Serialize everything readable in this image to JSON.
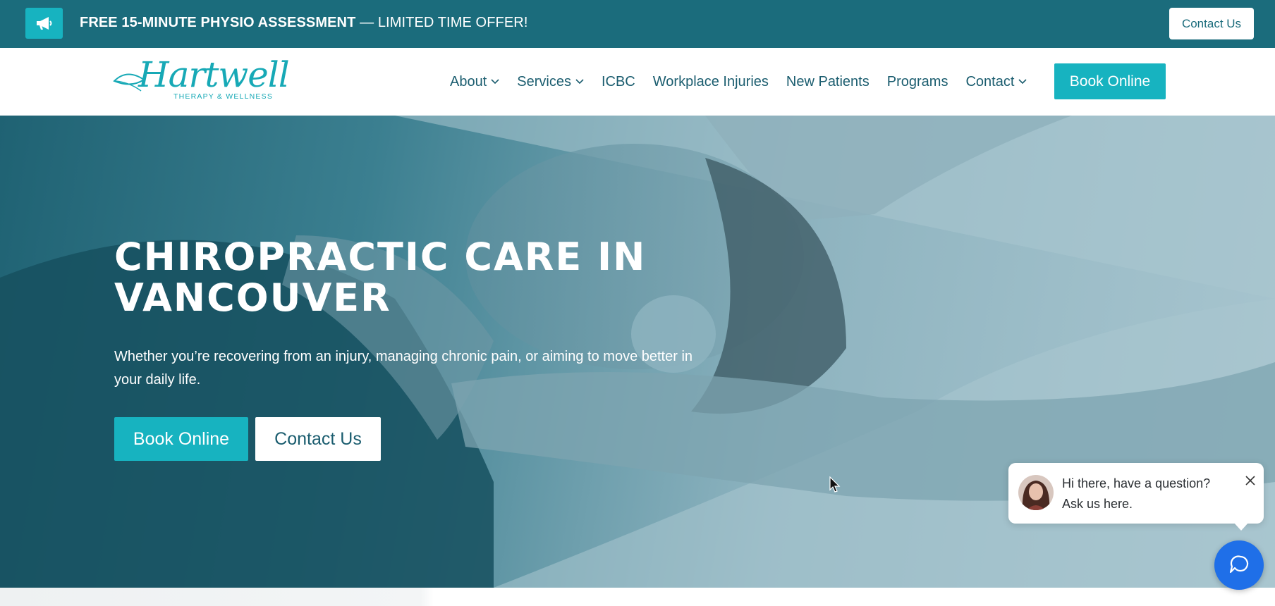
{
  "announcement": {
    "icon": "megaphone-icon",
    "headline": "FREE 15-MINUTE PHYSIO ASSESSMENT",
    "tagline": " — LIMITED TIME OFFER!",
    "contact_label": "Contact Us"
  },
  "header": {
    "logo_name": "Hartwell",
    "logo_tagline": "THERAPY & WELLNESS",
    "nav": [
      {
        "label": "About",
        "dropdown": true
      },
      {
        "label": "Services",
        "dropdown": true
      },
      {
        "label": "ICBC",
        "dropdown": false
      },
      {
        "label": "Workplace Injuries",
        "dropdown": false
      },
      {
        "label": "New Patients",
        "dropdown": false
      },
      {
        "label": "Programs",
        "dropdown": false
      },
      {
        "label": "Contact",
        "dropdown": true
      }
    ],
    "book_label": "Book Online"
  },
  "hero": {
    "title": "CHIROPRACTIC CARE IN VANCOUVER",
    "subtitle": "Whether you’re recovering from an injury, managing chronic pain, or aiming to move better in your daily life.",
    "book_label": "Book Online",
    "contact_label": "Contact Us"
  },
  "chat": {
    "message": "Hi there, have a question? Ask us here.",
    "launcher_icon": "chat-icon",
    "close_icon": "close-icon"
  },
  "colors": {
    "topbar": "#1b6c7c",
    "accent": "#17b3c0",
    "nav_text": "#1b5d6f",
    "chat_launcher": "#1f6fe8"
  }
}
